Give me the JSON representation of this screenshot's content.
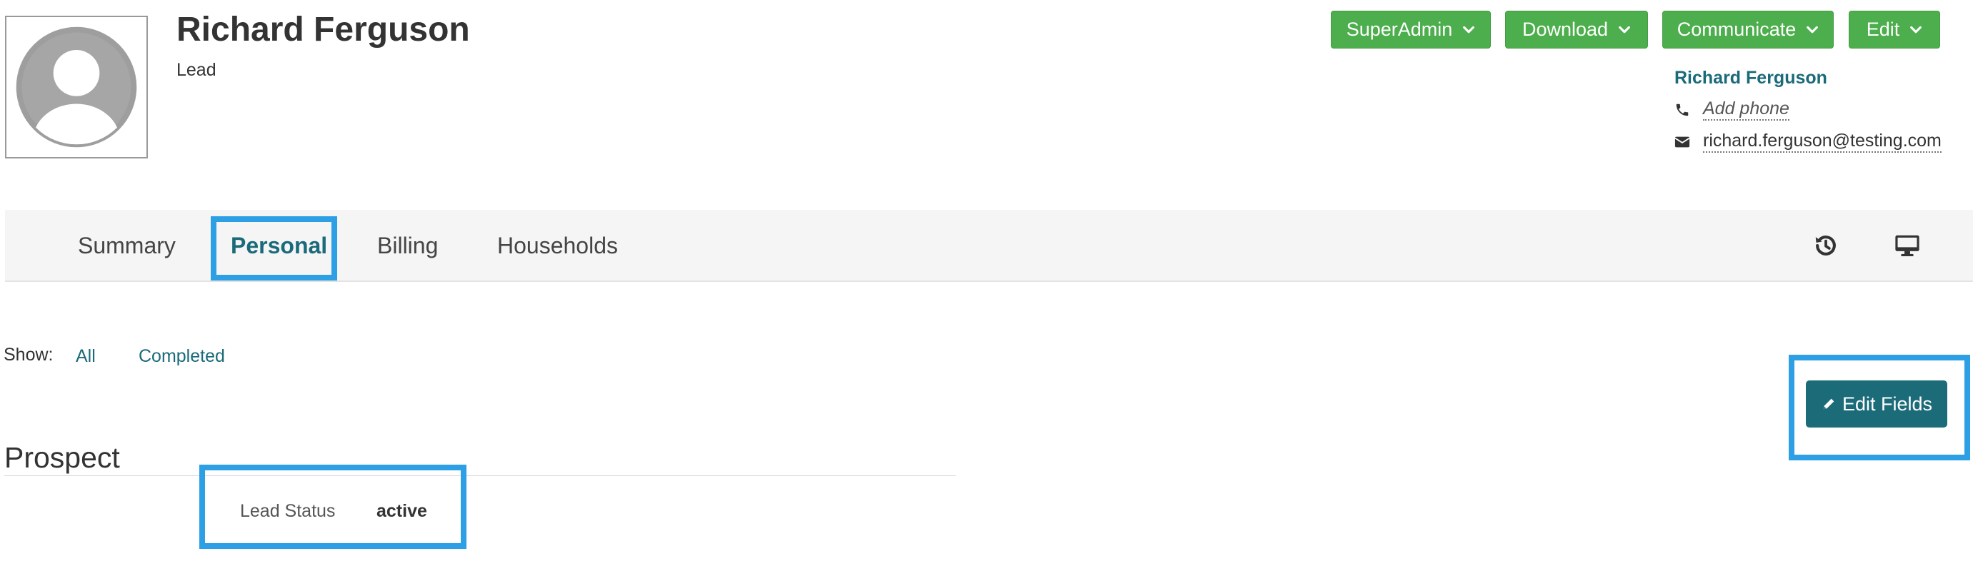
{
  "profile": {
    "name": "Richard Ferguson",
    "role": "Lead",
    "avatar_icon": "user-placeholder-icon"
  },
  "actions": {
    "superadmin_label": "SuperAdmin",
    "download_label": "Download",
    "communicate_label": "Communicate",
    "edit_label": "Edit",
    "button_color": "#4cae4c",
    "dropdown_icon": "chevron-down-icon"
  },
  "contact": {
    "name": "Richard Ferguson",
    "phone_placeholder": "Add phone",
    "email": "richard.ferguson@testing.com",
    "phone_icon": "phone-icon",
    "email_icon": "envelope-icon"
  },
  "tabs": {
    "summary": "Summary",
    "personal": "Personal",
    "billing": "Billing",
    "households": "Households",
    "active": "Personal",
    "history_icon": "history-icon",
    "monitor_icon": "monitor-icon",
    "accent_color": "#1a6a7a"
  },
  "filter": {
    "label": "Show:",
    "options": [
      "All",
      "Completed"
    ]
  },
  "edit_fields": {
    "label": "Edit Fields",
    "icon": "pencil-icon",
    "color": "#1b6b79"
  },
  "section": {
    "title": "Prospect",
    "fields": [
      {
        "label": "Lead Status",
        "value": "active"
      }
    ]
  },
  "highlight_color": "#2c9fe5"
}
